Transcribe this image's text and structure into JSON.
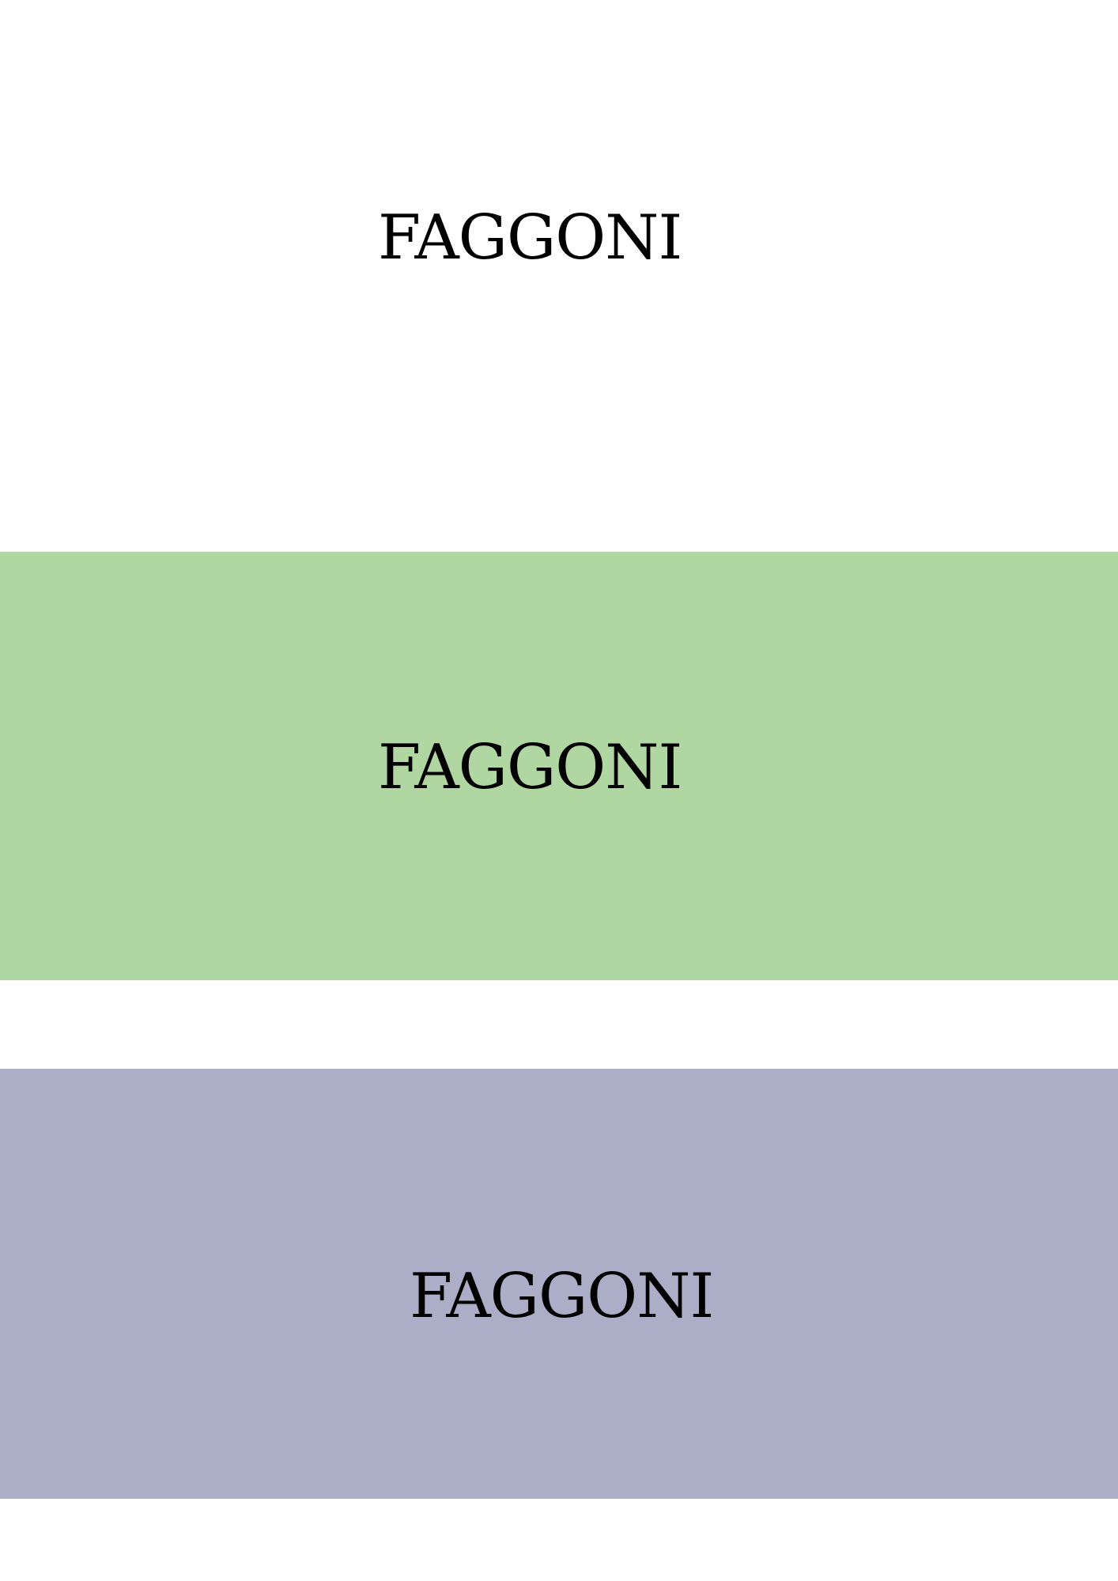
{
  "colors": {
    "background": "#ffffff",
    "green_band": "#b0d6a2",
    "purple_band": "#acaec8",
    "text": "#000000"
  },
  "panels": [
    {
      "variant": "white",
      "logo_text": "FAGGONI"
    },
    {
      "variant": "green",
      "logo_text": "FAGGONI"
    },
    {
      "variant": "purple",
      "logo_text": "FAGGONI"
    }
  ]
}
